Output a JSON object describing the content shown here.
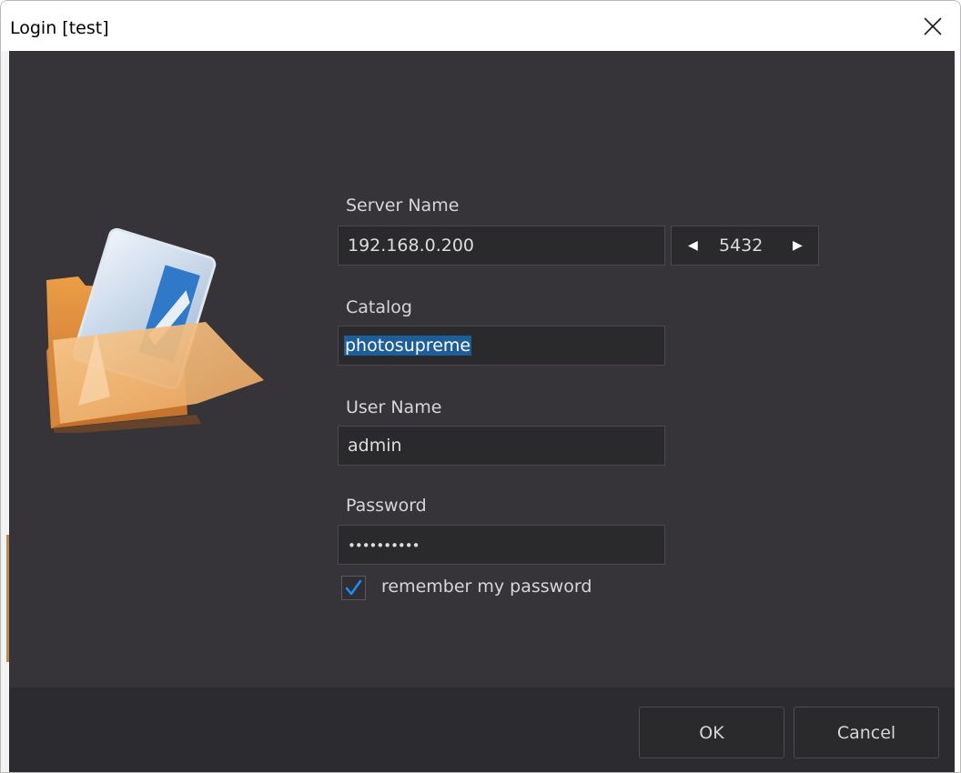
{
  "window": {
    "title": "Login [test]"
  },
  "form": {
    "server_label": "Server Name",
    "server_value": "192.168.0.200",
    "port_value": "5432",
    "catalog_label": "Catalog",
    "catalog_value": "photosupreme",
    "username_label": "User Name",
    "username_value": "admin",
    "password_label": "Password",
    "password_value": "••••••••••",
    "remember_label": "remember my password",
    "remember_checked": true
  },
  "buttons": {
    "ok": "OK",
    "cancel": "Cancel"
  },
  "icons": {
    "close": "close-icon",
    "port_decrement": "triangle-left-icon",
    "port_increment": "triangle-right-icon",
    "logo": "folder-photo-logo",
    "check": "checkmark-icon"
  },
  "colors": {
    "client_bg": "#363438",
    "footer_bg": "#2c2b2f",
    "field_bg": "#2a292c",
    "selection": "#1d5d98",
    "check_accent": "#1e90ff"
  }
}
